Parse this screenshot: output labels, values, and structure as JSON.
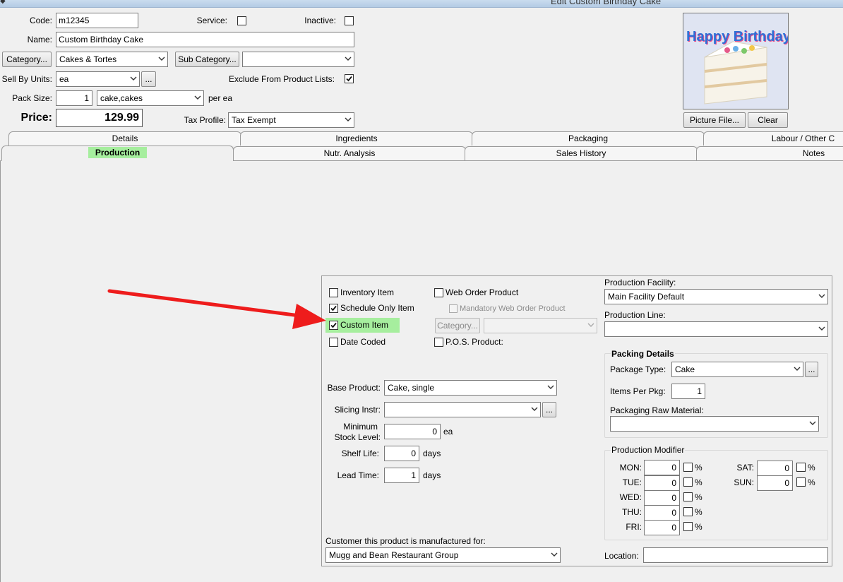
{
  "window": {
    "title": "Edit Custom Birthday Cake"
  },
  "header": {
    "code_label": "Code:",
    "code_value": "m12345",
    "service_label": "Service:",
    "inactive_label": "Inactive:",
    "name_label": "Name:",
    "name_value": "Custom Birthday Cake",
    "category_button": "Category...",
    "category_value": "Cakes & Tortes",
    "subcategory_button": "Sub Category...",
    "subcategory_value": "",
    "sell_by_units_label": "Sell By Units:",
    "sell_by_units_value": "ea",
    "ellipsis": "...",
    "exclude_label": "Exclude From Product Lists:",
    "pack_size_label": "Pack Size:",
    "pack_size_value": "1",
    "pack_unit_value": "cake,cakes",
    "per_ea": "per ea",
    "price_label": "Price:",
    "price_value": "129.99",
    "tax_profile_label": "Tax Profile:",
    "tax_profile_value": "Tax Exempt"
  },
  "picture": {
    "text": "Happy Birthday!",
    "picture_file_button": "Picture File...",
    "clear_button": "Clear"
  },
  "tabs": {
    "row1": [
      "Details",
      "Ingredients",
      "Packaging",
      "Labour / Other C"
    ],
    "row2": [
      "Production",
      "Nutr. Analysis",
      "Sales History",
      "Notes"
    ],
    "active": "Production"
  },
  "production": {
    "inventory_item": "Inventory Item",
    "schedule_only_item": "Schedule Only Item",
    "custom_item": "Custom Item",
    "date_coded": "Date Coded",
    "web_order_product": "Web Order Product",
    "mandatory_web_order_product": "Mandatory Web Order Product",
    "category_button": "Category...",
    "pos_product": "P.O.S. Product:",
    "base_product_label": "Base Product:",
    "base_product_value": "Cake, single",
    "slicing_label": "Slicing Instr:",
    "slicing_value": "",
    "min_stock_label_1": "Minimum",
    "min_stock_label_2": "Stock Level:",
    "min_stock_value": "0",
    "min_stock_unit": "ea",
    "shelf_life_label": "Shelf Life:",
    "shelf_life_value": "0",
    "shelf_life_unit": "days",
    "lead_time_label": "Lead Time:",
    "lead_time_value": "1",
    "lead_time_unit": "days",
    "customer_label": "Customer this product is manufactured for:",
    "customer_value": "Mugg and Bean Restaurant Group",
    "facility_label": "Production Facility:",
    "facility_value": "Main Facility Default",
    "line_label": "Production Line:",
    "line_value": "",
    "location_label": "Location:",
    "location_value": ""
  },
  "packing": {
    "title": "Packing Details",
    "package_type_label": "Package Type:",
    "package_type_value": "Cake",
    "items_per_pkg_label": "Items Per Pkg:",
    "items_per_pkg_value": "1",
    "raw_material_label": "Packaging Raw Material:",
    "raw_material_value": ""
  },
  "modifier": {
    "title": "Production Modifier",
    "percent": "%",
    "days": [
      {
        "label": "MON:",
        "value": "0"
      },
      {
        "label": "TUE:",
        "value": "0"
      },
      {
        "label": "WED:",
        "value": "0"
      },
      {
        "label": "THU:",
        "value": "0"
      },
      {
        "label": "FRI:",
        "value": "0"
      },
      {
        "label": "SAT:",
        "value": "0"
      },
      {
        "label": "SUN:",
        "value": "0"
      }
    ]
  },
  "checks": {
    "service": false,
    "inactive": false,
    "exclude": true,
    "inventory_item": false,
    "schedule_only_item": true,
    "custom_item": true,
    "date_coded": false,
    "web_order_product": false,
    "mandatory_web_order_product": false,
    "pos_product": false
  },
  "colors": {
    "highlight_green": "#a6ee9e",
    "arrow_red": "#ee1c1c"
  }
}
